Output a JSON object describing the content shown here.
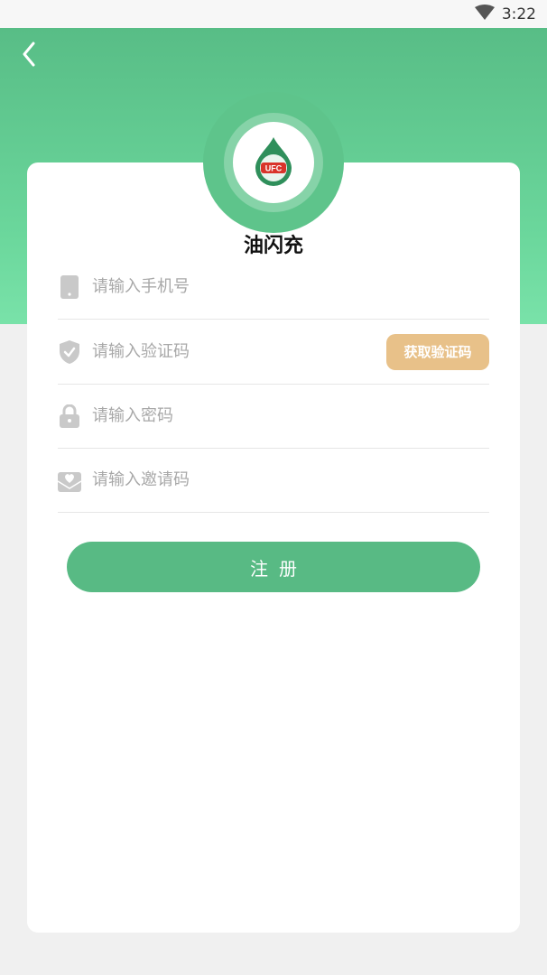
{
  "status_bar": {
    "time": "3:22",
    "wifi_icon": "wifi-icon"
  },
  "header": {
    "back_icon": "chevron-left-icon",
    "app_name": "油闪充",
    "logo_icon": "drop-logo-icon",
    "logo_text": "UFC",
    "gradient_top": "#58bd86",
    "gradient_bottom": "#79e2a9"
  },
  "form": {
    "phone": {
      "placeholder": "请输入手机号",
      "value": "",
      "icon": "phone-icon"
    },
    "code": {
      "placeholder": "请输入验证码",
      "value": "",
      "icon": "shield-check-icon",
      "button_label": "获取验证码"
    },
    "password": {
      "placeholder": "请输入密码",
      "value": "",
      "icon": "lock-icon"
    },
    "invite": {
      "placeholder": "请输入邀请码",
      "value": "",
      "icon": "envelope-heart-icon"
    }
  },
  "register_button": {
    "label": "注册"
  },
  "colors": {
    "primary": "#58ba84",
    "code_button": "#e8c189",
    "page_bg": "#f0f0f0"
  }
}
